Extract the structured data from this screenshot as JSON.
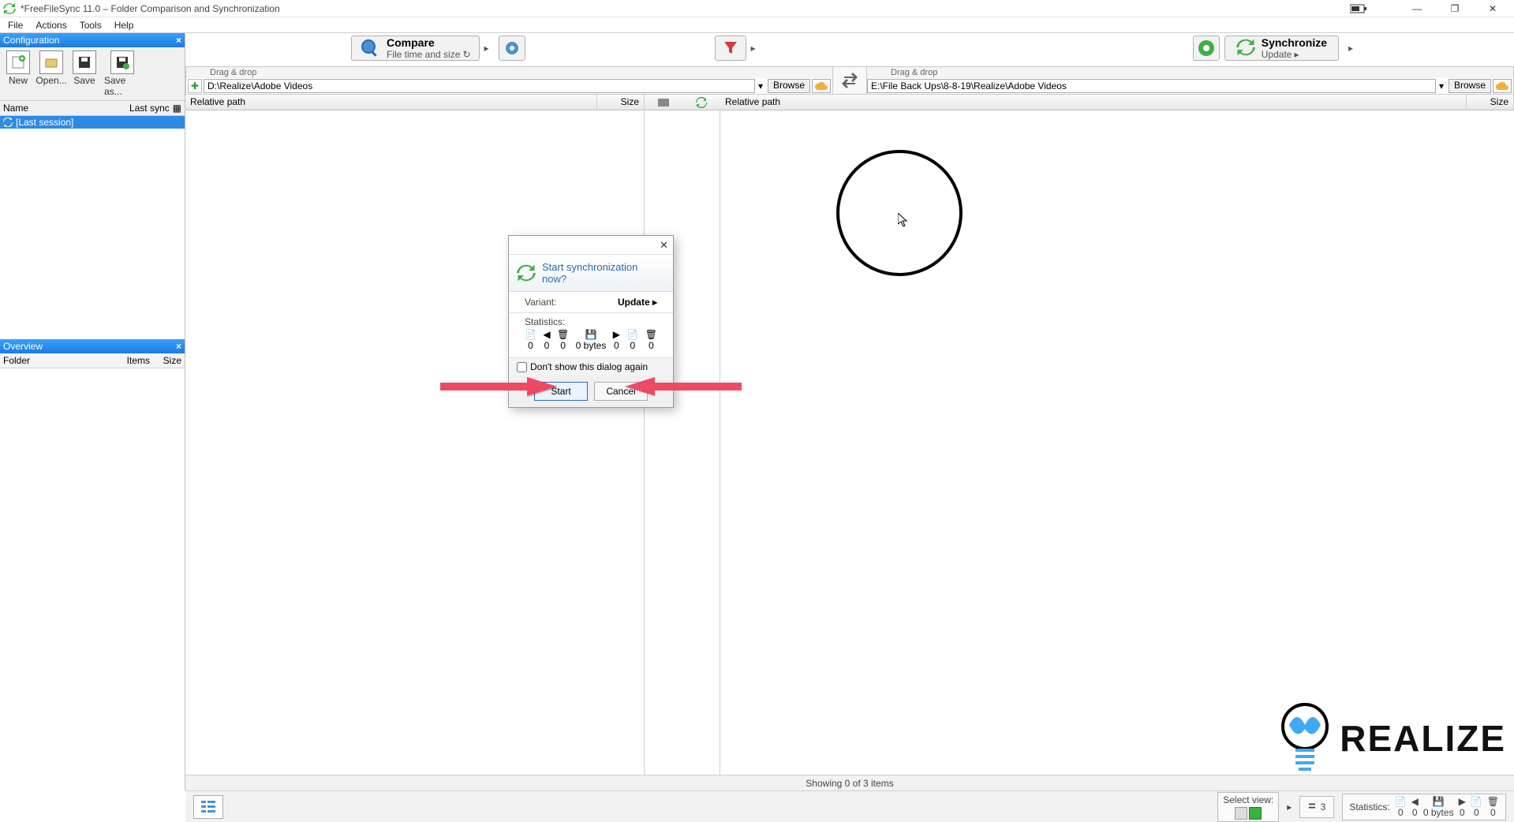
{
  "title": "*FreeFileSync 11.0 – Folder Comparison and Synchronization",
  "menu": {
    "file": "File",
    "actions": "Actions",
    "tools": "Tools",
    "help": "Help"
  },
  "config_panel": {
    "header": "Configuration",
    "buttons": {
      "new": "New",
      "open": "Open...",
      "save": "Save",
      "save_as": "Save as..."
    },
    "list_header": {
      "name": "Name",
      "last_sync": "Last sync"
    },
    "items": [
      {
        "label": "[Last session]"
      }
    ]
  },
  "overview_panel": {
    "header": "Overview",
    "columns": {
      "folder": "Folder",
      "items": "Items",
      "size": "Size"
    }
  },
  "toolbar": {
    "compare": {
      "label": "Compare",
      "sub": "File time and size"
    },
    "sync": {
      "label": "Synchronize",
      "sub": "Update"
    }
  },
  "paths": {
    "drag_hint": "Drag & drop",
    "left": "D:\\Realize\\Adobe Videos",
    "right": "E:\\File Back Ups\\8-8-19\\Realize\\Adobe Videos",
    "browse": "Browse"
  },
  "grid": {
    "left": {
      "path": "Relative path",
      "size": "Size"
    },
    "right": {
      "path": "Relative path",
      "size": "Size"
    }
  },
  "status": {
    "showing": "Showing 0 of 3 items"
  },
  "footer": {
    "select_view": "Select view:",
    "count": "3",
    "stats_label": "Statistics:",
    "stats": [
      "0",
      "0",
      "0 bytes",
      "0",
      "0",
      "0"
    ]
  },
  "dialog": {
    "question": "Start synchronization now?",
    "variant_label": "Variant:",
    "variant_value": "Update",
    "stats_label": "Statistics:",
    "stats": [
      "0",
      "0",
      "0",
      "0 bytes",
      "0",
      "0",
      "0"
    ],
    "checkbox": "Don't show this dialog again",
    "start": "Start",
    "cancel": "Cancel"
  },
  "watermark": "REALIZE"
}
